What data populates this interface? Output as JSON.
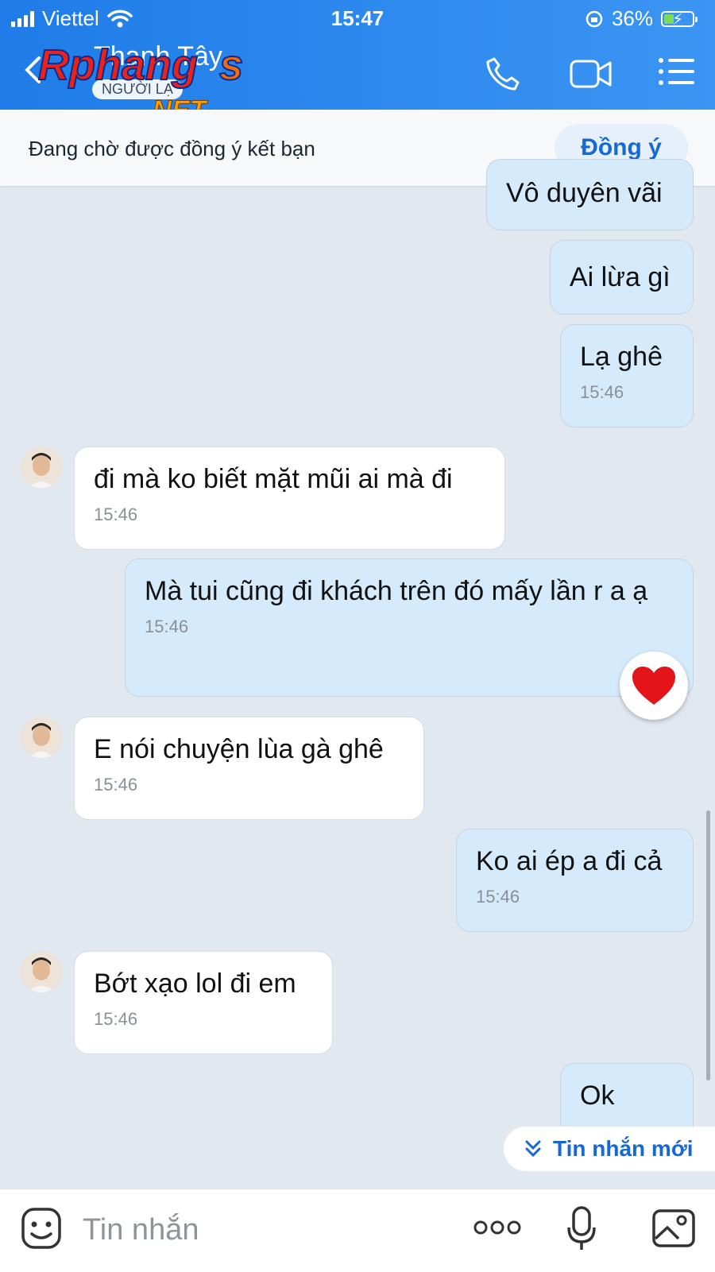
{
  "status_bar": {
    "carrier": "Viettel",
    "time": "15:47",
    "battery": "36%",
    "battery_level": 0.36
  },
  "header": {
    "contact_name": "Thanh Tây",
    "badge": "NGƯỜI LẠ",
    "watermark_text": "Rphangs.NET"
  },
  "banner": {
    "text": "Đang chờ được đồng ý kết bạn",
    "button": "Đồng ý"
  },
  "messages": [
    {
      "side": "out",
      "text": "Vô duyên vãi",
      "time": ""
    },
    {
      "side": "out",
      "text": "Ai lừa gì",
      "time": ""
    },
    {
      "side": "out",
      "text": "Lạ ghê",
      "time": "15:46"
    },
    {
      "side": "in",
      "text": "đi mà ko biết mặt mũi ai mà đi",
      "time": "15:46"
    },
    {
      "side": "out",
      "text": "Mà tui cũng đi khách trên đó mấy lần r a ạ",
      "time": "15:46",
      "reaction": "heart"
    },
    {
      "side": "in",
      "text": "E nói chuyện lùa gà ghê",
      "time": "15:46"
    },
    {
      "side": "out",
      "text": "Ko ai ép a đi cả",
      "time": "15:46"
    },
    {
      "side": "in",
      "text": "Bớt xạo lol đi em",
      "time": "15:46"
    },
    {
      "side": "out",
      "text": "Ok",
      "time": ""
    }
  ],
  "new_messages_label": "Tin nhắn mới",
  "input": {
    "placeholder": "Tin nhắn"
  },
  "colors": {
    "header": "#2f8af0",
    "outgoing_bubble": "#d5ebfb",
    "incoming_bubble": "#ffffff",
    "accent": "#1668d6",
    "background": "#e2e8f0"
  },
  "icons": [
    "back-icon",
    "phone-icon",
    "video-call-icon",
    "menu-icon",
    "sticker-icon",
    "more-icon",
    "microphone-icon",
    "image-icon",
    "heart-reaction-icon",
    "chevron-double-down-icon"
  ]
}
